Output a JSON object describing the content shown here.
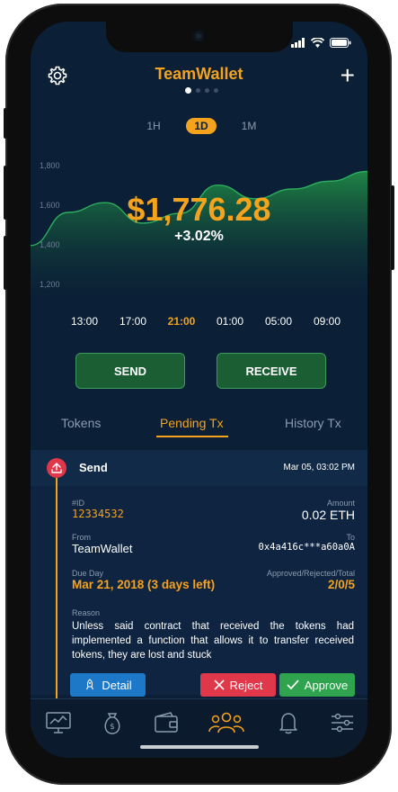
{
  "app": {
    "title": "TeamWallet",
    "page_dots": 4,
    "active_dot": 0
  },
  "status_bar": {
    "icons": [
      "signal-icon",
      "wifi-icon",
      "battery-icon"
    ]
  },
  "header": {
    "left_icon": "gear-icon",
    "right_icon": "plus-icon",
    "plus_label": "+"
  },
  "time_ranges": {
    "items": [
      "1H",
      "1D",
      "1M"
    ],
    "active": "1D"
  },
  "chart_data": {
    "type": "area",
    "x": [
      "13:00",
      "17:00",
      "21:00",
      "01:00",
      "05:00",
      "09:00"
    ],
    "y_ticks": [
      "1,800",
      "1,600",
      "1,400",
      "1,200"
    ],
    "ylim": [
      1200,
      1800
    ],
    "values": [
      1390,
      1560,
      1610,
      1505,
      1555,
      1700,
      1630,
      1680,
      1720,
      1770
    ],
    "active_x": "21:00",
    "color": "#1f8a45"
  },
  "balance": {
    "price": "$1,776.28",
    "change": "+3.02%"
  },
  "actions": {
    "send_label": "SEND",
    "receive_label": "RECEIVE"
  },
  "tabs": {
    "items": [
      "Tokens",
      "Pending Tx",
      "History Tx"
    ],
    "active": "Pending Tx"
  },
  "transaction": {
    "type_label": "Send",
    "datetime": "Mar 05, 03:02 PM",
    "id_label": "#ID",
    "id_value": "12334532",
    "amount_label": "Amount",
    "amount_value": "0.02 ETH",
    "from_label": "From",
    "from_value": "TeamWallet",
    "to_label": "To",
    "to_value": "0x4a416c***a60a0A",
    "due_label": "Due Day",
    "due_value": "Mar 21, 2018 (3 days left)",
    "arr_label": "Approved/Rejected/Total",
    "arr_value": "2/0/5",
    "reason_label": "Reason",
    "reason_text": "Unless said contract that received the tokens had implemented a function that allows it to transfer received tokens, they are lost and stuck",
    "detail_label": "Detail",
    "reject_label": "Reject",
    "approve_label": "Approve"
  },
  "bottom_nav": {
    "items": [
      "chart-monitor-icon",
      "money-bag-icon",
      "wallet-icon",
      "team-icon",
      "bell-icon",
      "settings-sliders-icon"
    ],
    "active": "team-icon"
  },
  "colors": {
    "accent": "#f5a21d",
    "green": "#1b5e34",
    "reject": "#e0374a",
    "approve": "#2fa34e",
    "detail": "#1e78c8",
    "background": "#0b2036"
  }
}
